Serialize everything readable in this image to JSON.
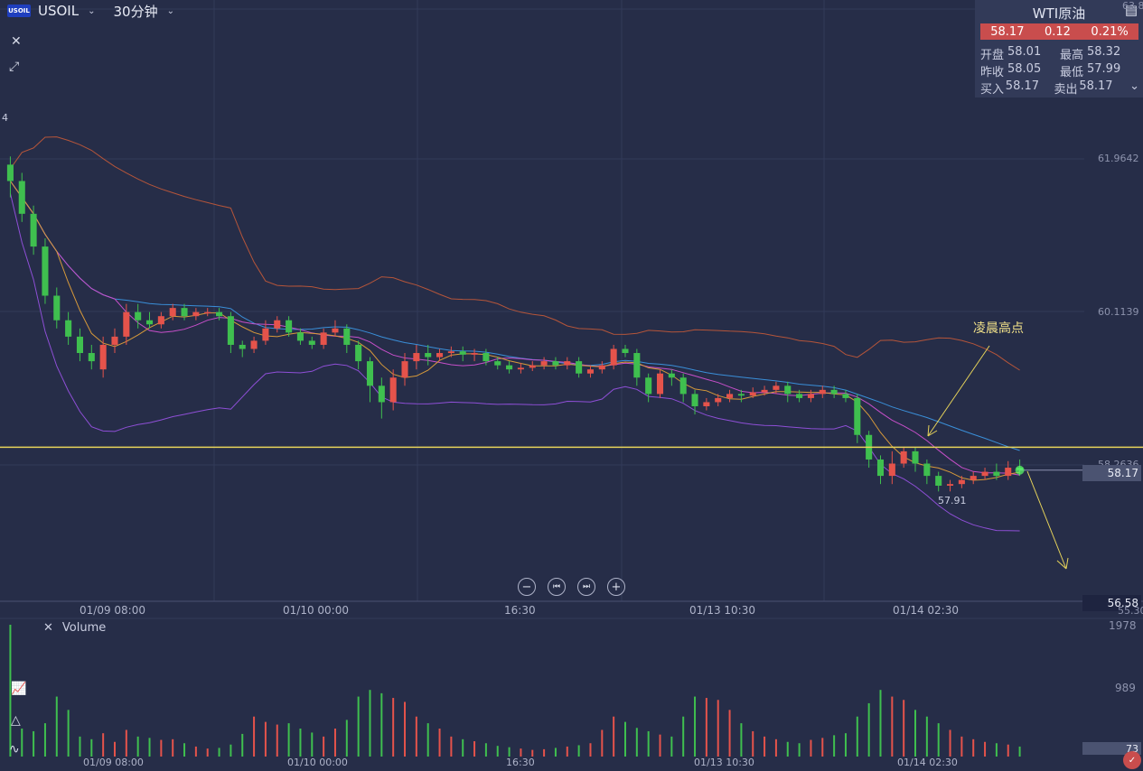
{
  "header": {
    "logo_text": "USOIL",
    "symbol": "USOIL",
    "interval": "30分钟"
  },
  "quote_panel": {
    "title": "WTI原油",
    "last": "58.17",
    "change": "0.12",
    "change_pct": "0.21%",
    "rows": [
      {
        "k1": "开盘",
        "v1": "58.01",
        "k2": "最高",
        "v2": "58.32"
      },
      {
        "k1": "昨收",
        "v1": "58.05",
        "k2": "最低",
        "v2": "57.99"
      },
      {
        "k1": "买入",
        "v1": "58.17",
        "k2": "卖出",
        "v2": "58.17"
      }
    ],
    "up_color": "#c94d4d"
  },
  "y_labels": {
    "top": "63.8",
    "l1": "61.9642",
    "l2": "60.1139",
    "l3": "58.2636",
    "current": "58.17",
    "bottom": "56.58",
    "cut": "4",
    "bottom_cut": "55.30"
  },
  "x_labels": [
    "01/09 08:00",
    "01/10 00:00",
    "16:30",
    "01/13 10:30",
    "01/14 02:30"
  ],
  "annotations": {
    "label": "凌晨高点",
    "low_label": "57.91"
  },
  "volume": {
    "title": "Volume",
    "y_top": "1978",
    "y_mid": "989",
    "y_bottom": "73"
  },
  "colors": {
    "up": "#e5534b",
    "down": "#3fbf4f",
    "background": "#262d48",
    "hline": "#e6d35a"
  },
  "chart_data": {
    "type": "candlestick",
    "symbol": "USOIL",
    "interval": "30分钟",
    "ylim": [
      56.58,
      63.8
    ],
    "horizontal_line": 58.45,
    "candles": [
      {
        "o": 61.9,
        "c": 61.7,
        "h": 62.0,
        "l": 61.5
      },
      {
        "o": 61.7,
        "c": 61.3,
        "h": 61.8,
        "l": 61.2
      },
      {
        "o": 61.3,
        "c": 60.9,
        "h": 61.4,
        "l": 60.8
      },
      {
        "o": 60.9,
        "c": 60.3,
        "h": 61.0,
        "l": 60.2
      },
      {
        "o": 60.3,
        "c": 60.0,
        "h": 60.4,
        "l": 59.9
      },
      {
        "o": 60.0,
        "c": 59.8,
        "h": 60.1,
        "l": 59.7
      },
      {
        "o": 59.8,
        "c": 59.6,
        "h": 59.9,
        "l": 59.5
      },
      {
        "o": 59.6,
        "c": 59.5,
        "h": 59.7,
        "l": 59.4
      },
      {
        "o": 59.4,
        "c": 59.7,
        "h": 59.8,
        "l": 59.3
      },
      {
        "o": 59.7,
        "c": 59.8,
        "h": 59.9,
        "l": 59.6
      },
      {
        "o": 59.8,
        "c": 60.1,
        "h": 60.2,
        "l": 59.7
      },
      {
        "o": 60.1,
        "c": 60.0,
        "h": 60.2,
        "l": 59.9
      },
      {
        "o": 60.0,
        "c": 59.95,
        "h": 60.1,
        "l": 59.9
      },
      {
        "o": 59.95,
        "c": 60.05,
        "h": 60.1,
        "l": 59.9
      },
      {
        "o": 60.05,
        "c": 60.15,
        "h": 60.2,
        "l": 60.0
      },
      {
        "o": 60.15,
        "c": 60.05,
        "h": 60.2,
        "l": 60.0
      },
      {
        "o": 60.05,
        "c": 60.1,
        "h": 60.15,
        "l": 60.0
      },
      {
        "o": 60.1,
        "c": 60.1,
        "h": 60.15,
        "l": 60.05
      },
      {
        "o": 60.1,
        "c": 60.05,
        "h": 60.15,
        "l": 60.0
      },
      {
        "o": 60.05,
        "c": 59.7,
        "h": 60.1,
        "l": 59.6
      },
      {
        "o": 59.7,
        "c": 59.65,
        "h": 59.75,
        "l": 59.55
      },
      {
        "o": 59.65,
        "c": 59.75,
        "h": 59.8,
        "l": 59.6
      },
      {
        "o": 59.75,
        "c": 59.9,
        "h": 60.0,
        "l": 59.7
      },
      {
        "o": 59.9,
        "c": 60.0,
        "h": 60.05,
        "l": 59.85
      },
      {
        "o": 60.0,
        "c": 59.85,
        "h": 60.05,
        "l": 59.8
      },
      {
        "o": 59.85,
        "c": 59.75,
        "h": 59.9,
        "l": 59.7
      },
      {
        "o": 59.75,
        "c": 59.7,
        "h": 59.8,
        "l": 59.65
      },
      {
        "o": 59.7,
        "c": 59.85,
        "h": 59.9,
        "l": 59.65
      },
      {
        "o": 59.85,
        "c": 59.9,
        "h": 60.0,
        "l": 59.8
      },
      {
        "o": 59.9,
        "c": 59.7,
        "h": 59.95,
        "l": 59.6
      },
      {
        "o": 59.7,
        "c": 59.5,
        "h": 59.75,
        "l": 59.4
      },
      {
        "o": 59.5,
        "c": 59.2,
        "h": 59.55,
        "l": 59.0
      },
      {
        "o": 59.2,
        "c": 59.0,
        "h": 59.3,
        "l": 58.8
      },
      {
        "o": 59.0,
        "c": 59.3,
        "h": 59.4,
        "l": 58.9
      },
      {
        "o": 59.3,
        "c": 59.5,
        "h": 59.6,
        "l": 59.2
      },
      {
        "o": 59.5,
        "c": 59.6,
        "h": 59.7,
        "l": 59.4
      },
      {
        "o": 59.6,
        "c": 59.55,
        "h": 59.7,
        "l": 59.45
      },
      {
        "o": 59.55,
        "c": 59.6,
        "h": 59.65,
        "l": 59.5
      },
      {
        "o": 59.6,
        "c": 59.62,
        "h": 59.68,
        "l": 59.55
      },
      {
        "o": 59.62,
        "c": 59.58,
        "h": 59.68,
        "l": 59.5
      },
      {
        "o": 59.58,
        "c": 59.6,
        "h": 59.65,
        "l": 59.5
      },
      {
        "o": 59.6,
        "c": 59.5,
        "h": 59.65,
        "l": 59.45
      },
      {
        "o": 59.5,
        "c": 59.45,
        "h": 59.55,
        "l": 59.4
      },
      {
        "o": 59.45,
        "c": 59.4,
        "h": 59.5,
        "l": 59.35
      },
      {
        "o": 59.4,
        "c": 59.42,
        "h": 59.48,
        "l": 59.35
      },
      {
        "o": 59.42,
        "c": 59.45,
        "h": 59.5,
        "l": 59.38
      },
      {
        "o": 59.45,
        "c": 59.5,
        "h": 59.55,
        "l": 59.4
      },
      {
        "o": 59.5,
        "c": 59.45,
        "h": 59.55,
        "l": 59.4
      },
      {
        "o": 59.45,
        "c": 59.5,
        "h": 59.55,
        "l": 59.4
      },
      {
        "o": 59.5,
        "c": 59.35,
        "h": 59.55,
        "l": 59.3
      },
      {
        "o": 59.35,
        "c": 59.4,
        "h": 59.45,
        "l": 59.3
      },
      {
        "o": 59.4,
        "c": 59.45,
        "h": 59.5,
        "l": 59.35
      },
      {
        "o": 59.45,
        "c": 59.65,
        "h": 59.7,
        "l": 59.4
      },
      {
        "o": 59.65,
        "c": 59.6,
        "h": 59.7,
        "l": 59.55
      },
      {
        "o": 59.6,
        "c": 59.3,
        "h": 59.65,
        "l": 59.2
      },
      {
        "o": 59.3,
        "c": 59.1,
        "h": 59.35,
        "l": 59.0
      },
      {
        "o": 59.1,
        "c": 59.35,
        "h": 59.4,
        "l": 59.05
      },
      {
        "o": 59.35,
        "c": 59.3,
        "h": 59.4,
        "l": 59.2
      },
      {
        "o": 59.3,
        "c": 59.1,
        "h": 59.35,
        "l": 59.0
      },
      {
        "o": 59.1,
        "c": 58.95,
        "h": 59.15,
        "l": 58.85
      },
      {
        "o": 58.95,
        "c": 59.0,
        "h": 59.05,
        "l": 58.9
      },
      {
        "o": 59.0,
        "c": 59.05,
        "h": 59.1,
        "l": 58.95
      },
      {
        "o": 59.05,
        "c": 59.1,
        "h": 59.15,
        "l": 59.0
      },
      {
        "o": 59.1,
        "c": 59.08,
        "h": 59.15,
        "l": 59.0
      },
      {
        "o": 59.08,
        "c": 59.12,
        "h": 59.18,
        "l": 59.05
      },
      {
        "o": 59.12,
        "c": 59.15,
        "h": 59.2,
        "l": 59.08
      },
      {
        "o": 59.15,
        "c": 59.2,
        "h": 59.25,
        "l": 59.1
      },
      {
        "o": 59.2,
        "c": 59.1,
        "h": 59.25,
        "l": 59.0
      },
      {
        "o": 59.1,
        "c": 59.05,
        "h": 59.15,
        "l": 59.0
      },
      {
        "o": 59.05,
        "c": 59.1,
        "h": 59.15,
        "l": 59.0
      },
      {
        "o": 59.1,
        "c": 59.15,
        "h": 59.2,
        "l": 59.05
      },
      {
        "o": 59.15,
        "c": 59.1,
        "h": 59.2,
        "l": 59.05
      },
      {
        "o": 59.1,
        "c": 59.05,
        "h": 59.15,
        "l": 59.0
      },
      {
        "o": 59.05,
        "c": 58.6,
        "h": 59.1,
        "l": 58.5
      },
      {
        "o": 58.6,
        "c": 58.3,
        "h": 58.65,
        "l": 58.2
      },
      {
        "o": 58.3,
        "c": 58.1,
        "h": 58.35,
        "l": 58.0
      },
      {
        "o": 58.1,
        "c": 58.25,
        "h": 58.4,
        "l": 58.0
      },
      {
        "o": 58.25,
        "c": 58.4,
        "h": 58.45,
        "l": 58.2
      },
      {
        "o": 58.4,
        "c": 58.25,
        "h": 58.45,
        "l": 58.15
      },
      {
        "o": 58.25,
        "c": 58.1,
        "h": 58.3,
        "l": 58.0
      },
      {
        "o": 58.1,
        "c": 57.98,
        "h": 58.15,
        "l": 57.91
      },
      {
        "o": 57.98,
        "c": 58.0,
        "h": 58.05,
        "l": 57.91
      },
      {
        "o": 58.0,
        "c": 58.05,
        "h": 58.1,
        "l": 57.95
      },
      {
        "o": 58.05,
        "c": 58.1,
        "h": 58.15,
        "l": 58.0
      },
      {
        "o": 58.1,
        "c": 58.15,
        "h": 58.2,
        "l": 58.05
      },
      {
        "o": 58.15,
        "c": 58.1,
        "h": 58.25,
        "l": 58.05
      },
      {
        "o": 58.1,
        "c": 58.2,
        "h": 58.28,
        "l": 58.05
      },
      {
        "o": 58.2,
        "c": 58.17,
        "h": 58.3,
        "l": 58.1
      }
    ],
    "volume_values": [
      1978,
      420,
      380,
      500,
      900,
      700,
      300,
      260,
      350,
      220,
      400,
      300,
      280,
      250,
      260,
      200,
      150,
      120,
      130,
      180,
      340,
      600,
      520,
      480,
      500,
      420,
      360,
      300,
      420,
      550,
      900,
      1000,
      950,
      880,
      820,
      600,
      500,
      420,
      300,
      260,
      230,
      200,
      160,
      140,
      120,
      100,
      110,
      130,
      150,
      170,
      200,
      400,
      600,
      520,
      430,
      380,
      330,
      300,
      600,
      900,
      880,
      850,
      700,
      500,
      380,
      300,
      260,
      220,
      200,
      250,
      280,
      320,
      350,
      600,
      800,
      1000,
      900,
      850,
      700,
      600,
      500,
      400,
      300,
      260,
      220,
      200,
      180,
      150
    ]
  }
}
